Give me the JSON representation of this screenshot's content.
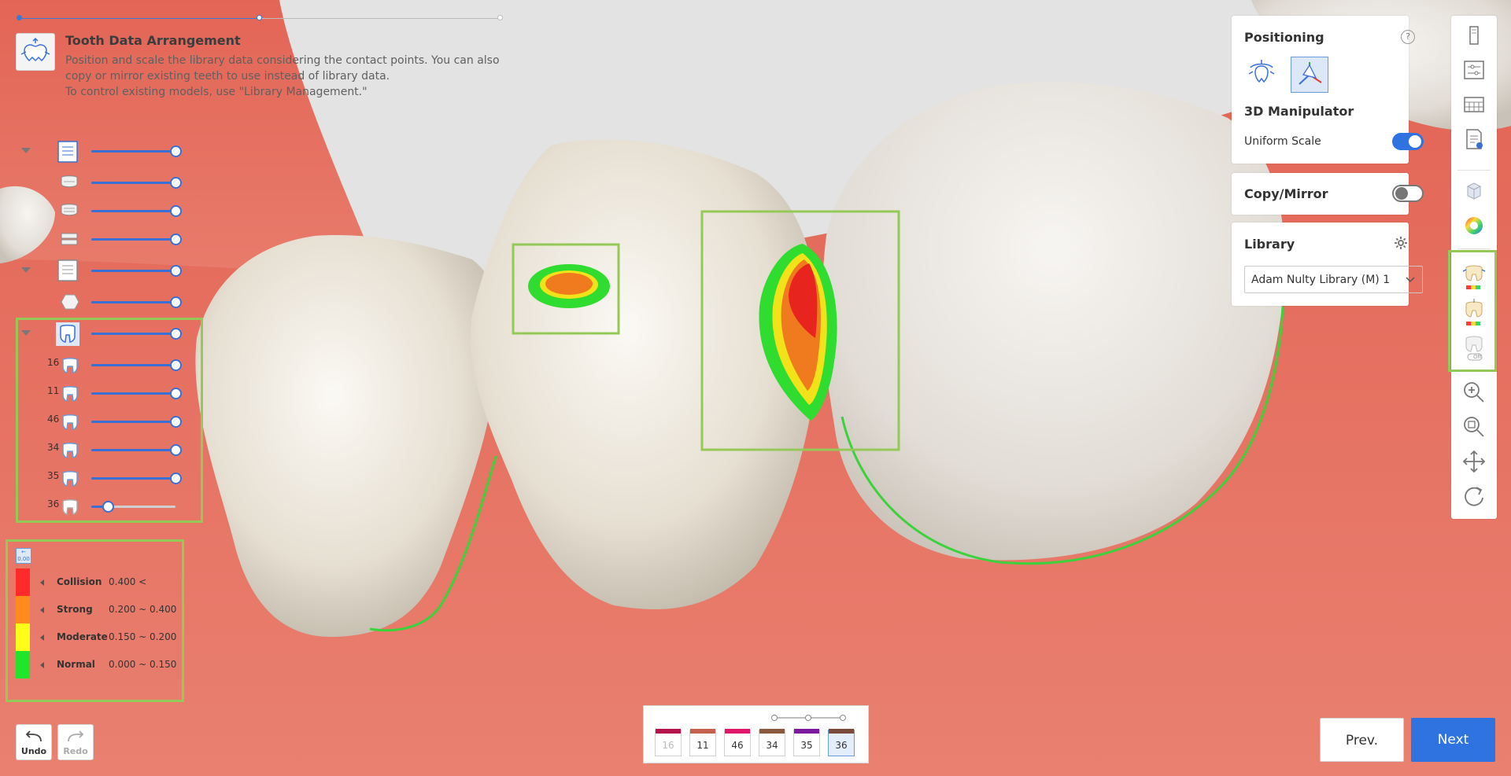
{
  "header": {
    "title": "Tooth Data Arrangement",
    "description_lines": [
      "Position and scale the library data considering the contact points. You can also",
      "copy or mirror existing teeth to use instead of library data.",
      "To control existing models, use \"Library Management.\""
    ]
  },
  "progress": {
    "value_fraction": 0.5
  },
  "tree": {
    "teeth": [
      {
        "number": "16",
        "value": 1.0
      },
      {
        "number": "11",
        "value": 1.0
      },
      {
        "number": "46",
        "value": 1.0
      },
      {
        "number": "34",
        "value": 1.0
      },
      {
        "number": "35",
        "value": 1.0
      },
      {
        "number": "36",
        "value": 0.2
      }
    ],
    "layer_values": [
      1.0,
      1.0,
      1.0,
      1.0,
      1.0,
      1.0,
      1.0
    ]
  },
  "legend": {
    "items": [
      {
        "name": "Collision",
        "range": "0.400 <",
        "color": "#ff2a2a"
      },
      {
        "name": "Strong",
        "range": "0.200 ~ 0.400",
        "color": "#ff8a1e"
      },
      {
        "name": "Moderate",
        "range": "0.150 ~ 0.200",
        "color": "#ffff1a"
      },
      {
        "name": "Normal",
        "range": "0.000 ~ 0.150",
        "color": "#21e52a"
      }
    ],
    "unit_badge": "0.00"
  },
  "history": {
    "undo_label": "Undo",
    "redo_label": "Redo"
  },
  "tooth_bar": {
    "chips": [
      {
        "label": "16",
        "color": "#b5134b",
        "disabled": true
      },
      {
        "label": "11",
        "color": "#c4614f",
        "disabled": false
      },
      {
        "label": "46",
        "color": "#e0176b",
        "disabled": false
      },
      {
        "label": "34",
        "color": "#8b5a3e",
        "disabled": false
      },
      {
        "label": "35",
        "color": "#7b1a9c",
        "disabled": false
      },
      {
        "label": "36",
        "color": "#7a4a3a",
        "selected": true
      }
    ]
  },
  "positioning": {
    "title": "Positioning",
    "help": "?",
    "section": "3D Manipulator",
    "uniform_scale_label": "Uniform Scale",
    "uniform_scale_on": true
  },
  "copy_mirror": {
    "title": "Copy/Mirror",
    "on": false
  },
  "library": {
    "title": "Library",
    "selected": "Adam Nulty Library (M) 1"
  },
  "nav": {
    "prev_label": "Prev.",
    "next_label": "Next"
  },
  "colors": {
    "gum": "#e56a5c",
    "tooth": "#ece6dc",
    "accent": "#2f73e0",
    "highlight": "#95c957"
  },
  "icons": {
    "right_toolbar": [
      "scan-icon",
      "settings-sliders-icon",
      "grid-icon",
      "report-icon",
      "cube-icon",
      "color-wheel-icon",
      "tooth-contact-icon",
      "tooth-distance-icon",
      "tooth-off-icon",
      "zoom-in-icon",
      "zoom-fit-icon",
      "pan-icon",
      "rotate-icon"
    ],
    "off_badge": "Off"
  }
}
